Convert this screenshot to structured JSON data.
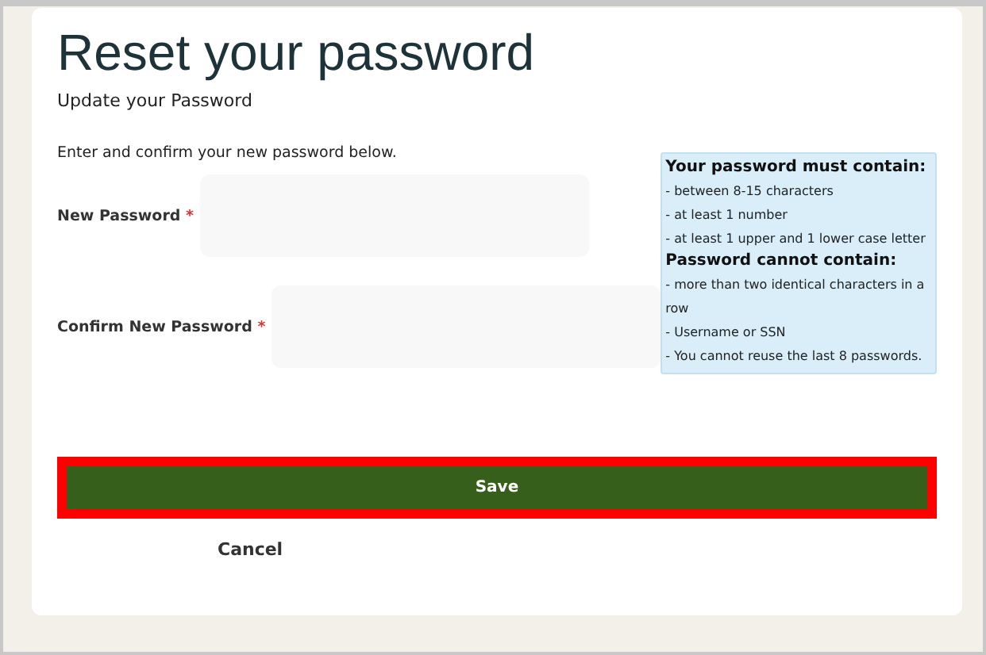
{
  "title": "Reset your password",
  "subtitle": "Update your Password",
  "instructions": "Enter and confirm your new password below.",
  "fields": [
    {
      "label": "New Password",
      "required_mark": "*"
    },
    {
      "label": "Confirm New Password",
      "required_mark": "*"
    }
  ],
  "requirements": [
    {
      "kind": "heading",
      "text": "Your password must contain:"
    },
    {
      "kind": "item",
      "text": "- between 8-15 characters"
    },
    {
      "kind": "item",
      "text": "- at least 1 number"
    },
    {
      "kind": "item",
      "text": "- at least 1 upper and 1 lower case letter"
    },
    {
      "kind": "heading",
      "text": "Password cannot contain:"
    },
    {
      "kind": "item",
      "text": "- more than two identical characters in a row"
    },
    {
      "kind": "item",
      "text": "- Username or SSN"
    },
    {
      "kind": "item",
      "text": "- You cannot reuse the last 8 passwords."
    }
  ],
  "save_button": {
    "label": "Save",
    "highlighted": true
  },
  "cancel_link": "Cancel"
}
